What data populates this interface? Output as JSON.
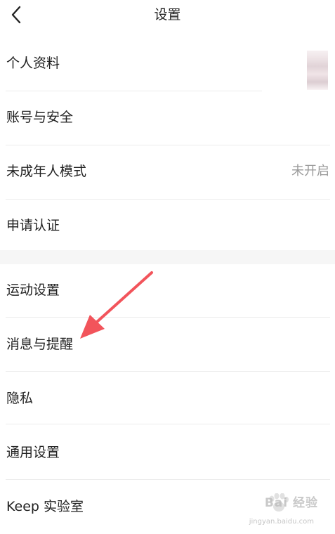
{
  "header": {
    "title": "设置",
    "back_icon": "chevron-left-icon"
  },
  "rows": {
    "profile": {
      "label": "个人资料"
    },
    "account": {
      "label": "账号与安全"
    },
    "minor_mode": {
      "label": "未成年人模式",
      "value": "未开启"
    },
    "verify": {
      "label": "申请认证"
    },
    "sport": {
      "label": "运动设置"
    },
    "notify": {
      "label": "消息与提醒"
    },
    "privacy": {
      "label": "隐私"
    },
    "general": {
      "label": "通用设置"
    },
    "lab": {
      "label": "Keep 实验室"
    }
  },
  "annotation": {
    "color": "#f2545b"
  },
  "watermark": {
    "brand": "Bai 经验",
    "url": "jingyan.baidu.com"
  }
}
